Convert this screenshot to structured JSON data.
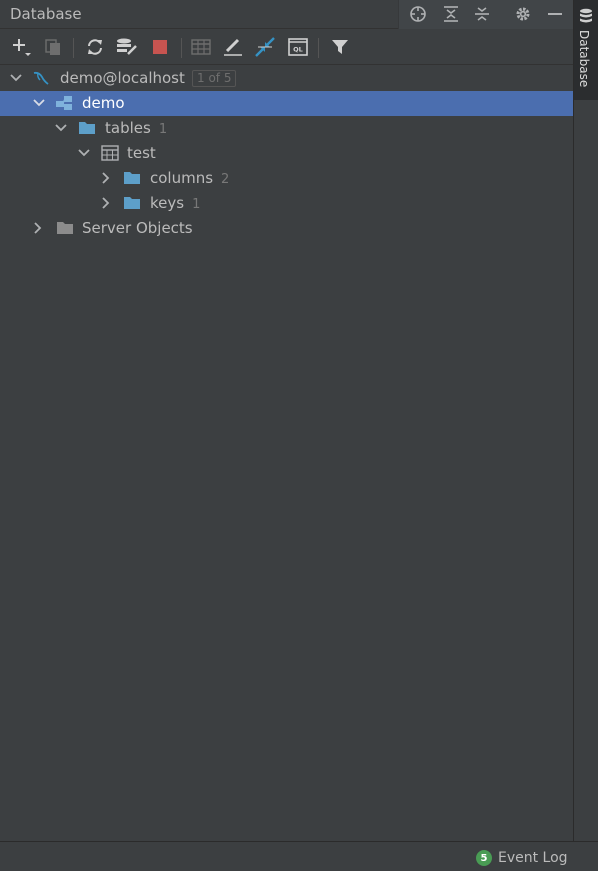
{
  "panel": {
    "title": "Database",
    "title_icons": [
      "crosshair-icon",
      "expand-all-icon",
      "collapse-all-icon",
      "gear-icon",
      "minimize-icon"
    ]
  },
  "toolbar": {
    "icons": [
      "add-icon",
      "duplicate-icon",
      "refresh-icon",
      "schema-properties-icon",
      "stop-icon",
      "table-editor-icon",
      "edit-icon",
      "jump-to-console-icon",
      "query-console-icon",
      "filter-icon"
    ]
  },
  "tree": {
    "connection": {
      "label": "demo@localhost",
      "badge": "1 of 5"
    },
    "schema": {
      "label": "demo"
    },
    "tables": {
      "label": "tables",
      "count": "1"
    },
    "table": {
      "label": "test"
    },
    "columns": {
      "label": "columns",
      "count": "2"
    },
    "keys": {
      "label": "keys",
      "count": "1"
    },
    "server_objects": {
      "label": "Server Objects"
    }
  },
  "right_strip": {
    "tab_label": "Database"
  },
  "status_bar": {
    "event_log_count": "5",
    "event_log_label": "Event Log"
  },
  "colors": {
    "background": "#3c3f41",
    "selection": "#4b6eaf",
    "folder": "#5d9fc9",
    "stop": "#c75450",
    "badge_green": "#499c54"
  }
}
